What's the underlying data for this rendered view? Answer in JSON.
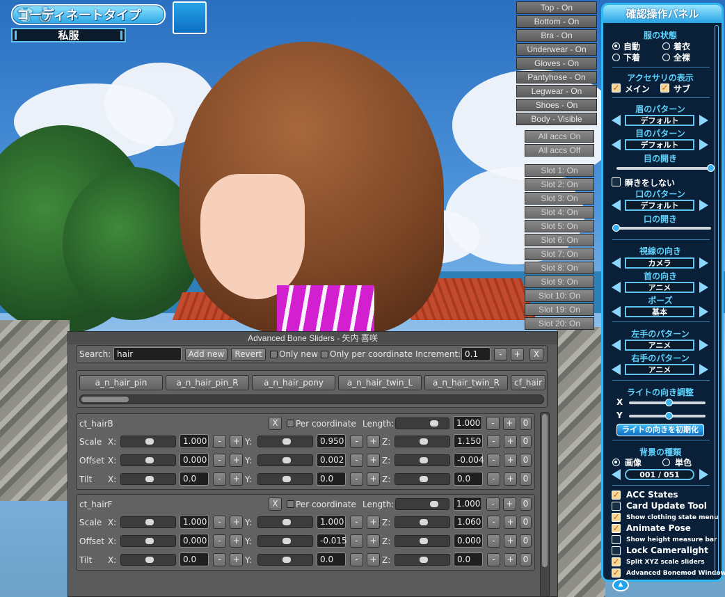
{
  "top_left": {
    "coordinate_type_label": "コーディネートタイプ",
    "coordinate_type_value": "私服",
    "icons": [
      "shirt-icon",
      "ring-icon"
    ]
  },
  "clothing_toggles": [
    "Top - On",
    "Bottom - On",
    "Bra - On",
    "Underwear - On",
    "Gloves - On",
    "Pantyhose - On",
    "Legwear - On",
    "Shoes - On",
    "Body - Visible"
  ],
  "accessory_toggles": {
    "all_on": "All accs On",
    "all_off": "All accs Off",
    "slots": [
      "Slot 1: On",
      "Slot 2: On",
      "Slot 3: On",
      "Slot 4: On",
      "Slot 5: On",
      "Slot 6: On",
      "Slot 7: On",
      "Slot 8: On",
      "Slot 9: On",
      "Slot 10: On",
      "Slot 19: On",
      "Slot 20: On"
    ]
  },
  "panel": {
    "title": "確認操作パネル",
    "clothes_state": {
      "heading": "服の状態",
      "auto": "自動",
      "dressed": "着衣",
      "underwear": "下着",
      "nude": "全裸",
      "selected": "自動"
    },
    "accessory_display": {
      "heading": "アクセサリの表示",
      "main": "メイン",
      "sub": "サブ",
      "main_checked": true,
      "sub_checked": true
    },
    "eyebrow": {
      "heading": "眉のパターン",
      "value": "デフォルト"
    },
    "eye": {
      "heading": "目のパターン",
      "value": "デフォルト"
    },
    "eye_open": {
      "heading": "目の開き",
      "level": 1.0
    },
    "no_blink": {
      "label": "瞬きをしない",
      "checked": false
    },
    "mouth": {
      "heading": "口のパターン",
      "value": "デフォルト"
    },
    "mouth_open": {
      "heading": "口の開き",
      "level": 0.0
    },
    "gaze": {
      "heading": "視線の向き",
      "value": "カメラ"
    },
    "neck": {
      "heading": "首の向き",
      "value": "アニメ"
    },
    "pose": {
      "heading": "ポーズ",
      "value": "基本"
    },
    "left_hand": {
      "heading": "左手のパターン",
      "value": "アニメ"
    },
    "right_hand": {
      "heading": "右手のパターン",
      "value": "アニメ"
    },
    "light": {
      "heading": "ライトの向き調整",
      "x_label": "X",
      "y_label": "Y",
      "x_level": 0.45,
      "y_level": 0.45,
      "reset": "ライトの向きを初期化"
    },
    "background": {
      "heading": "背景の種類",
      "image": "画像",
      "solid": "単色",
      "selected": "画像",
      "counter": "001 / 051"
    },
    "options": [
      {
        "label": "ACC States",
        "checked": true,
        "small": false
      },
      {
        "label": "Card Update Tool",
        "checked": false,
        "small": false
      },
      {
        "label": "Show clothing state menu",
        "checked": true,
        "small": true
      },
      {
        "label": "Animate Pose",
        "checked": true,
        "small": false
      },
      {
        "label": "Show height measure bar",
        "checked": false,
        "small": true
      },
      {
        "label": "Lock Cameralight",
        "checked": false,
        "small": false
      },
      {
        "label": "Split XYZ scale sliders",
        "checked": true,
        "small": true
      },
      {
        "label": "Advanced Bonemod Window",
        "checked": true,
        "small": true
      }
    ],
    "colors": {
      "accent": "#2fb8f3",
      "bg": "#092038",
      "heading": "#5fd4ff"
    }
  },
  "bone_window": {
    "title": "Advanced Bone Sliders - 矢内 喜咲",
    "search_label": "Search:",
    "search_value": "hair",
    "add_new": "Add new",
    "revert": "Revert",
    "only_new": "Only new",
    "only_per_coordinate": "Only per coordinate",
    "increment_label": "Increment:",
    "increment_value": "0.1",
    "minus": "-",
    "plus": "+",
    "close": "X",
    "bone_tabs": [
      "a_n_hair_pin",
      "a_n_hair_pin_R",
      "a_n_hair_pony",
      "a_n_hair_twin_L",
      "a_n_hair_twin_R",
      "cf_hair"
    ],
    "bones": [
      {
        "name": "ct_hairB",
        "x_btn": "X",
        "per_coordinate": "Per coordinate",
        "length_label": "Length:",
        "length": "1.000",
        "zero": "0",
        "rows": [
          {
            "label": "Scale",
            "x": "1.000",
            "y": "0.950",
            "z": "1.150"
          },
          {
            "label": "Offset",
            "x": "0.000",
            "y": "0.002",
            "z": "-0.004"
          },
          {
            "label": "Tilt",
            "x": "0.0",
            "y": "0.0",
            "z": "0.0"
          }
        ]
      },
      {
        "name": "ct_hairF",
        "x_btn": "X",
        "per_coordinate": "Per coordinate",
        "length_label": "Length:",
        "length": "1.000",
        "zero": "0",
        "rows": [
          {
            "label": "Scale",
            "x": "1.000",
            "y": "1.000",
            "z": "1.060"
          },
          {
            "label": "Offset",
            "x": "0.000",
            "y": "-0.015",
            "z": "0.000"
          },
          {
            "label": "Tilt",
            "x": "0.0",
            "y": "0.0",
            "z": "0.0"
          }
        ]
      }
    ],
    "axis_labels": {
      "x": "X:",
      "y": "Y:",
      "z": "Z:"
    }
  }
}
